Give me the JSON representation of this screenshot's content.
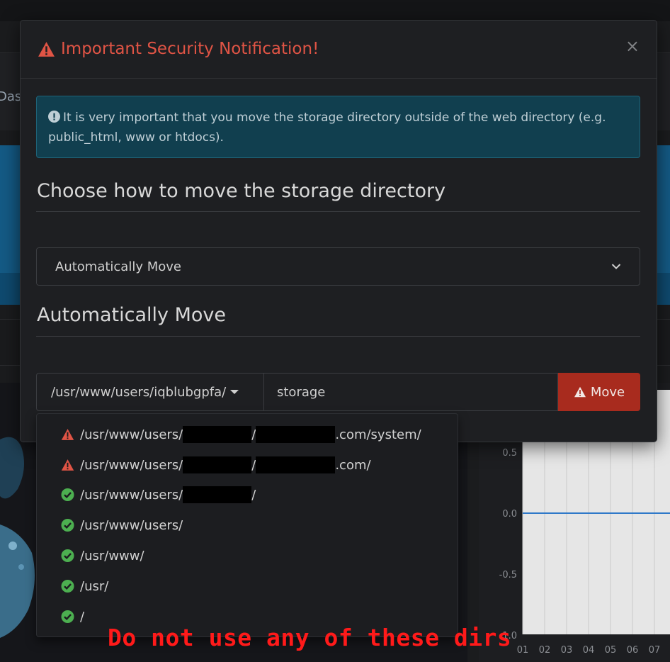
{
  "background": {
    "dash_text": "Dasl",
    "chart": {
      "y_ticks": [
        "0.5",
        "0.0",
        "-0.5",
        "-1.0"
      ],
      "x_ticks": [
        "01",
        "02",
        "03",
        "04",
        "05",
        "06",
        "07"
      ],
      "line_color": "#2f79c9"
    }
  },
  "modal": {
    "title": "Important Security Notification!",
    "close_label": "×",
    "alert_text": "It is very important that you move the storage directory outside of the web directory (e.g. public_html, www or htdocs).",
    "section1_heading": "Choose how to move the storage directory",
    "method_select": {
      "selected": "Automatically Move"
    },
    "section2_heading": "Automatically Move",
    "path_dropdown": {
      "value": "/usr/www/users/iqblubgpfa/"
    },
    "folder_input": {
      "value": "storage"
    },
    "move_button": "Move"
  },
  "dropdown_items": [
    {
      "status": "warning",
      "icon": "warning-triangle-icon",
      "prefix": "/usr/www/users/",
      "mid": "/",
      "suffix": ".com/system/"
    },
    {
      "status": "warning",
      "icon": "warning-triangle-icon",
      "prefix": "/usr/www/users/",
      "mid": "/",
      "suffix": ".com/"
    },
    {
      "status": "ok",
      "icon": "check-circle-icon",
      "prefix": "/usr/www/users/",
      "mid": "/",
      "suffix": ""
    },
    {
      "status": "ok",
      "icon": "check-circle-icon",
      "label": "/usr/www/users/"
    },
    {
      "status": "ok",
      "icon": "check-circle-icon",
      "label": "/usr/www/"
    },
    {
      "status": "ok",
      "icon": "check-circle-icon",
      "label": "/usr/"
    },
    {
      "status": "ok",
      "icon": "check-circle-icon",
      "label": "/"
    }
  ],
  "annotation": "Do not use any of these dirs",
  "colors": {
    "danger": "#e05445",
    "success": "#4caf50",
    "move_button": "#a82b1e",
    "alert_bg": "#113f4f",
    "annotation": "#ff1a1a"
  }
}
